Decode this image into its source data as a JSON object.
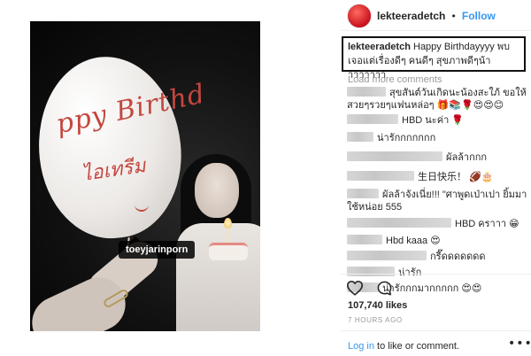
{
  "post": {
    "photo_tag": "toeyjarinporn",
    "balloon_line1": "ppy Birthd",
    "balloon_line2": "ไอเทรีม"
  },
  "header": {
    "username": "lekteeradetch",
    "separator": "•",
    "follow_label": "Follow"
  },
  "caption": {
    "username": "lekteeradetch",
    "text": "Happy Birthdayyyy พบเจอแต่เรื่องดีๆ คนดีๆ สุขภาพดีๆน้าาาาาาาา"
  },
  "load_more_label": "Load more comments",
  "comments": [
    {
      "text": "สุขสันต์วันเกิดนะน้องสะใภ้ ขอให้สวยๆรวยๆแฟนหล่อๆ",
      "emoji": "🎁📚🌹😍😍😊"
    },
    {
      "text": "HBD นะค่า",
      "emoji": "🌹"
    },
    {
      "text": "น่ารักกกกกกก",
      "emoji": ""
    },
    {
      "text": "ผัลล้ากกก",
      "emoji": ""
    },
    {
      "text": "生日快乐！",
      "emoji": "🏈🎂"
    },
    {
      "text": "ผัลล้าจังเนี่ย!!! \"ศาพูดเป่าเปา ยิ้มมาใช้หน่อย 555",
      "emoji": ""
    },
    {
      "text": "HBD คราาา",
      "emoji": "😁"
    },
    {
      "text": "Hbd kaaa",
      "emoji": "😍"
    },
    {
      "text": "กรี๊ดดดดดดด",
      "emoji": ""
    },
    {
      "text": "น่ารัก",
      "emoji": ""
    },
    {
      "text": "น่ารักกกมากกกกก",
      "emoji": "😍😍"
    }
  ],
  "actions": {
    "like_icon": "heart-outline-icon",
    "comment_icon": "speech-bubble-icon"
  },
  "likes_text": "107,740 likes",
  "time_text": "7 HOURS AGO",
  "footer": {
    "login_link": "Log in",
    "login_rest": " to like or comment.",
    "more_icon": "more-dots-icon"
  },
  "colors": {
    "link_blue": "#3897f0",
    "caption_border": "#111111",
    "meta_gray": "#999999"
  }
}
